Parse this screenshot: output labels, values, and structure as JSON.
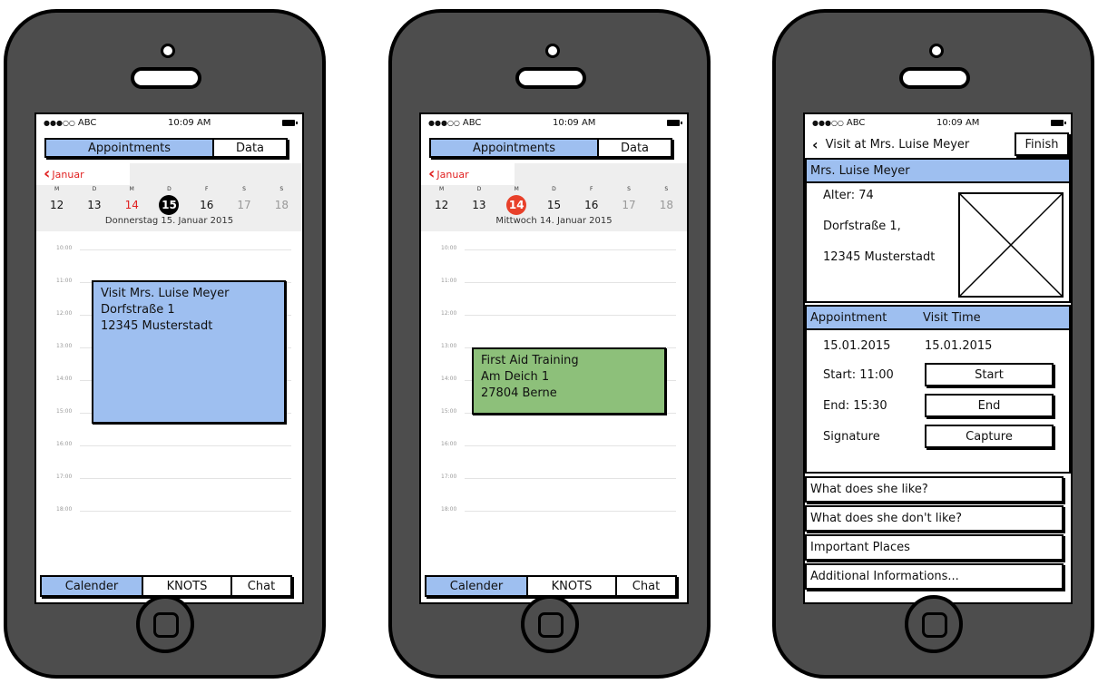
{
  "status": {
    "carrier": "ABC",
    "time": "10:09 AM"
  },
  "screens": [
    {
      "segment": {
        "left": "Appointments",
        "right": "Data"
      },
      "calendar": {
        "month": "Januar",
        "weekdays": [
          "M",
          "D",
          "M",
          "D",
          "F",
          "S",
          "S"
        ],
        "dates": [
          "12",
          "13",
          "14",
          "15",
          "16",
          "17",
          "18"
        ],
        "full_date": "Donnerstag  15. Januar 2015"
      },
      "timeline_hours": [
        "10:00",
        "11:00",
        "12:00",
        "13:00",
        "14:00",
        "15:00",
        "16:00",
        "17:00",
        "18:00"
      ],
      "event": {
        "line1": "Visit Mrs. Luise Meyer",
        "line2": "Dorfstraße 1",
        "line3": "12345 Musterstadt",
        "color": "#9ebff0"
      },
      "tabs": {
        "calendar": "Calender",
        "knots": "KNOTS",
        "chat": "Chat"
      }
    },
    {
      "segment": {
        "left": "Appointments",
        "right": "Data"
      },
      "calendar": {
        "month": "Januar",
        "weekdays": [
          "M",
          "D",
          "M",
          "D",
          "F",
          "S",
          "S"
        ],
        "dates": [
          "12",
          "13",
          "14",
          "15",
          "16",
          "17",
          "18"
        ],
        "full_date": "Mittwoch  14. Januar 2015"
      },
      "timeline_hours": [
        "10:00",
        "11:00",
        "12:00",
        "13:00",
        "14:00",
        "15:00",
        "16:00",
        "17:00",
        "18:00"
      ],
      "event": {
        "line1": "First Aid Training",
        "line2": "Am Deich 1",
        "line3": "27804 Berne",
        "color": "#8dc07a"
      },
      "tabs": {
        "calendar": "Calender",
        "knots": "KNOTS",
        "chat": "Chat"
      }
    }
  ],
  "detail": {
    "nav_title": "Visit at Mrs. Luise Meyer",
    "finish": "Finish",
    "person_header": "Mrs. Luise Meyer",
    "age": "Alter: 74",
    "street": "Dorfstraße 1,",
    "city": "12345 Musterstadt",
    "appt_header": "Appointment",
    "visit_header": "Visit Time",
    "appt_date": "15.01.2015",
    "visit_date": "15.01.2015",
    "start_label": "Start: 11:00",
    "start_btn": "Start",
    "end_label": "End: 15:30",
    "end_btn": "End",
    "signature_label": "Signature",
    "capture_btn": "Capture",
    "sections": [
      "What does she like?",
      "What does she don't like?",
      "Important Places",
      "Additional Informations..."
    ]
  },
  "colors": {
    "accent_blue": "#9ebff0",
    "event_green": "#8dc07a",
    "calendar_red": "#e02020"
  }
}
